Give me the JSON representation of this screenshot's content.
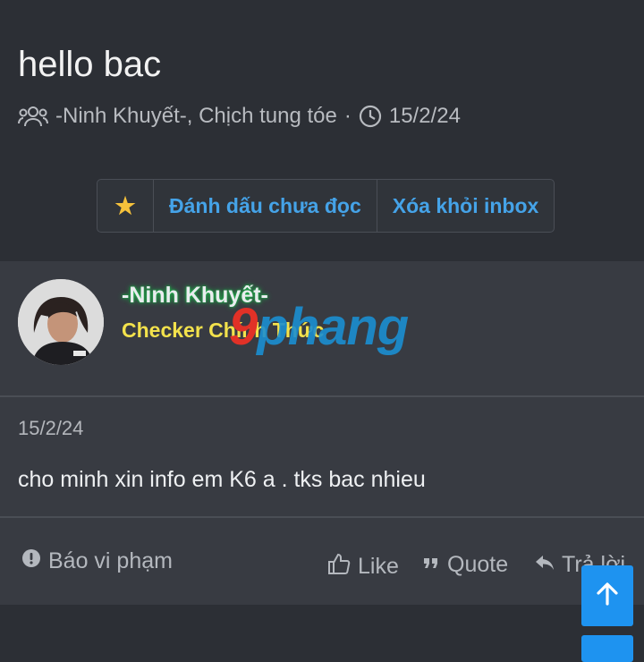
{
  "thread": {
    "title": "hello bac",
    "participants": "-Ninh Khuyết-, Chịch tung tóe",
    "separator": "·",
    "date": "15/2/24"
  },
  "toolbar": {
    "star_icon": "★",
    "mark_unread_label": "Đánh dấu chưa đọc",
    "remove_inbox_label": "Xóa khỏi inbox"
  },
  "post": {
    "author_name": "-Ninh Khuyết-",
    "author_role": "Checker Chính Thức",
    "watermark_part1": "9",
    "watermark_part2": "phang",
    "date": "15/2/24",
    "message": "cho minh xin info em K6 a . tks bac nhieu"
  },
  "actions": {
    "report_label": "Báo vi phạm",
    "like_label": "Like",
    "quote_label": "Quote",
    "reply_label": "Trả lời"
  },
  "colors": {
    "background": "#2c2f35",
    "post_background": "#383b42",
    "link": "#45a3e8",
    "star": "#f6c23b",
    "role": "#f3e24c",
    "name_glow": "#19c24a",
    "scroll_button": "#1e93f0"
  },
  "icons": {
    "participants": "users-icon",
    "time": "clock-icon",
    "report": "alert-icon",
    "like": "thumbs-up-icon",
    "quote": "quote-icon",
    "reply": "reply-icon",
    "scroll_top": "arrow-up-icon"
  }
}
